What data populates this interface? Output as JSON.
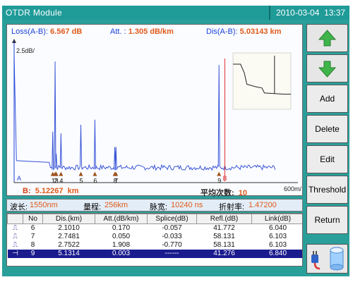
{
  "titlebar": {
    "title": "OTDR Module",
    "date": "2010-03-04",
    "time": "13:37"
  },
  "readouts": {
    "loss_label": "Loss(A-B):",
    "loss_value": "6.567 dB",
    "att_label": "Att.  :",
    "att_value": "1.305 dB/km",
    "dis_label": "Dis(A-B):",
    "dis_value": "5.03143 km",
    "b_label": "B:",
    "b_value": "5.12267",
    "b_unit": "km",
    "avg_label": "平均次数:",
    "avg_value": "10"
  },
  "chart_data": {
    "type": "line",
    "title": "",
    "xlabel": "",
    "ylabel": "",
    "y_scale_label": "2.5dB/",
    "x_scale_label": "600m/",
    "xlim": [
      0,
      12
    ],
    "ylim": [
      0,
      8
    ],
    "trace_color": "#3a56d8",
    "cursor_a_color": "#1a3fd8",
    "cursor_b_color": "#e03535",
    "cursor_a_label": "A",
    "cursor_b_label": "B",
    "cursor_a_km": 0,
    "cursor_b_km": 9.0,
    "baseline_db": 0.8,
    "noise_db": 0.15,
    "events": [
      {
        "label": "1",
        "x_km": 1.65,
        "peak_db": 2.9
      },
      {
        "label": "2",
        "x_km": 1.75,
        "peak_db": 7.0
      },
      {
        "label": "3",
        "x_km": 1.8,
        "peak_db": 1.6
      },
      {
        "label": "4",
        "x_km": 2.0,
        "peak_db": 2.8
      },
      {
        "label": "5",
        "x_km": 2.85,
        "peak_db": 3.3
      },
      {
        "label": "6",
        "x_km": 3.45,
        "peak_db": 3.6
      },
      {
        "label": "7",
        "x_km": 4.35,
        "peak_db": 2.0
      },
      {
        "label": "8",
        "x_km": 4.3,
        "peak_db": 2.0
      },
      {
        "label": "9",
        "x_km": 8.75,
        "peak_db": 6.8
      }
    ],
    "overview": {
      "trace": [
        [
          0,
          3.6
        ],
        [
          0.6,
          3.6
        ],
        [
          0.9,
          2.9
        ],
        [
          1.1,
          2.0
        ],
        [
          1.8,
          1.8
        ],
        [
          2.3,
          1.7
        ],
        [
          2.5,
          1.3
        ],
        [
          4.1,
          1.2
        ],
        [
          4.6,
          1.2
        ]
      ],
      "spike_x": 3.3,
      "xlim": [
        0,
        4.6
      ],
      "ylim": [
        0,
        4.5
      ]
    }
  },
  "params": {
    "wavelength_label": "波长:",
    "wavelength_value": "1550nm",
    "range_label": "量程:",
    "range_value": "256km",
    "pulse_label": "脉宽:",
    "pulse_value": "10240 ns",
    "ior_label": "折射率:",
    "ior_value": "1.47200"
  },
  "events_table": {
    "headers": [
      "",
      "No",
      "Dis.(km)",
      "Att.(dB/km)",
      "Splice(dB)",
      "Refl.(dB)",
      "Link(dB)"
    ],
    "rows": [
      {
        "type": "⎍",
        "no": "6",
        "dis": "2.1010",
        "att": "0.170",
        "splice": "-0.057",
        "refl": "41.772",
        "link": "6.040"
      },
      {
        "type": "⎍",
        "no": "7",
        "dis": "2.7481",
        "att": "0.050",
        "splice": "-0.033",
        "refl": "58.131",
        "link": "6.103"
      },
      {
        "type": "⎍",
        "no": "8",
        "dis": "2.7522",
        "att": "1.908",
        "splice": "-0.770",
        "refl": "58.131",
        "link": "6.103"
      },
      {
        "type": "⊣",
        "no": "9",
        "dis": "5.1314",
        "att": "0.003",
        "splice": "------",
        "refl": "41.276",
        "link": "6.840"
      }
    ],
    "selected_row": 3
  },
  "buttons": {
    "add": "Add",
    "delete": "Delete",
    "edit": "Edit",
    "threshold": "Threshold",
    "return": "Return"
  },
  "colors": {
    "frame": "#2a9f9a",
    "arrow_green": "#3fb54a",
    "event_marker": "#a0521d"
  }
}
